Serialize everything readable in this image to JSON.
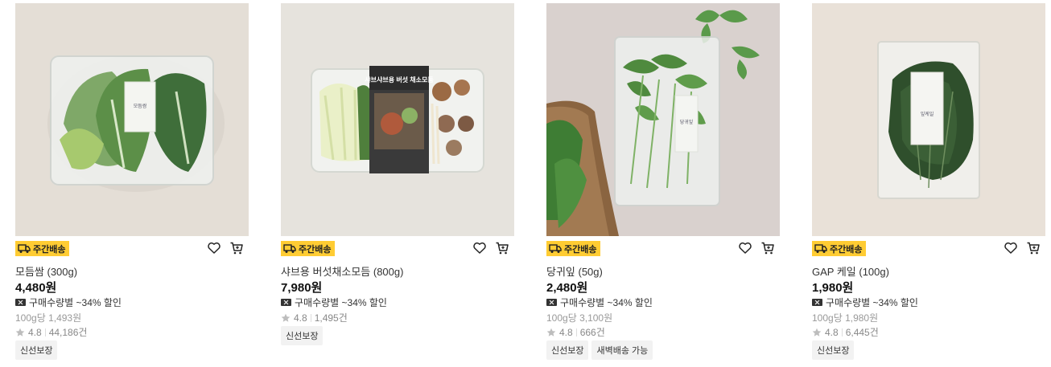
{
  "colors": {
    "badge": "#ffcc33",
    "name": "#333333",
    "price": "#111111",
    "unit": "#999999",
    "chip_bg": "#f2f2f2"
  },
  "products": [
    {
      "badge": "주간배송",
      "name": "모듬쌈 (300g)",
      "price": "4,480원",
      "discount": "구매수량별 ~34% 할인",
      "unit_price": "100g당 1,493원",
      "rating": "4.8",
      "review_count": "44,186건",
      "chips": [
        "신선보장"
      ],
      "package_label": "모듬쌈"
    },
    {
      "badge": "주간배송",
      "name": "샤브용 버섯채소모듬 (800g)",
      "price": "7,980원",
      "discount": "구매수량별 ~34% 할인",
      "unit_price": "",
      "rating": "4.8",
      "review_count": "1,495건",
      "chips": [
        "신선보장"
      ],
      "package_label": "샤브샤브용 버섯 채소모둠"
    },
    {
      "badge": "주간배송",
      "name": "당귀잎 (50g)",
      "price": "2,480원",
      "discount": "구매수량별 ~34% 할인",
      "unit_price": "100g당 3,100원",
      "rating": "4.8",
      "review_count": "666건",
      "chips": [
        "신선보장",
        "새벽배송 가능"
      ],
      "package_label": "당귀잎"
    },
    {
      "badge": "주간배송",
      "name": "GAP 케일 (100g)",
      "price": "1,980원",
      "discount": "구매수량별 ~34% 할인",
      "unit_price": "100g당 1,980원",
      "rating": "4.8",
      "review_count": "6,445건",
      "chips": [
        "신선보장"
      ],
      "package_label": "잎케일"
    }
  ],
  "icons": {
    "badge": "truck-icon",
    "wish": "heart-icon",
    "cart": "cart-icon",
    "discount": "coupon-icon",
    "rating": "star-icon"
  }
}
